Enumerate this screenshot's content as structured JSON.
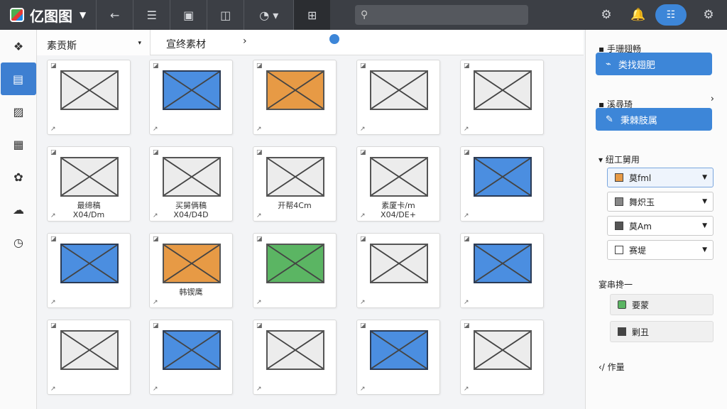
{
  "app": {
    "title": "亿图图"
  },
  "search": {
    "placeholder": ""
  },
  "panel": {
    "active_tab": "素贡斯",
    "second_tab": "宣终素材"
  },
  "cards": [
    {
      "label": "",
      "fill": "grey"
    },
    {
      "label": "",
      "fill": "blue"
    },
    {
      "label": "",
      "fill": "orange"
    },
    {
      "label": "",
      "fill": "grey"
    },
    {
      "label": "",
      "fill": "grey"
    },
    {
      "label": "最缔稿\nX04/Dm",
      "fill": "grey"
    },
    {
      "label": "买舅俩稿\nX04/D4D",
      "fill": "grey"
    },
    {
      "label": "开帮4Cm",
      "fill": "grey"
    },
    {
      "label": "素厦卡/m\nX04/DE+",
      "fill": "grey"
    },
    {
      "label": "",
      "fill": "blue"
    },
    {
      "label": "",
      "fill": "blue"
    },
    {
      "label": "韩锲鹰",
      "fill": "orange"
    },
    {
      "label": "",
      "fill": "green"
    },
    {
      "label": "",
      "fill": "grey"
    },
    {
      "label": "",
      "fill": "blue"
    },
    {
      "label": "",
      "fill": "grey"
    },
    {
      "label": "",
      "fill": "blue"
    },
    {
      "label": "",
      "fill": "grey"
    },
    {
      "label": "",
      "fill": "blue"
    },
    {
      "label": "",
      "fill": "grey"
    }
  ],
  "right": {
    "sec1_title": "手珊翅畅",
    "btn1": "类找翅肥",
    "sec2_title": "溪尋琦",
    "btn2": "秉棘肢属",
    "sec3_title": "纽工舅用",
    "dropdowns": [
      "莫fml",
      "舞炽玉",
      "莫Am",
      "赛堤"
    ],
    "sec4_title": "宴串搀一",
    "objects": [
      "要蒙",
      "剿丑"
    ],
    "sec5_title": "作量"
  },
  "colors": {
    "accent": "#3d86d8",
    "topbar": "#3c3f45"
  }
}
